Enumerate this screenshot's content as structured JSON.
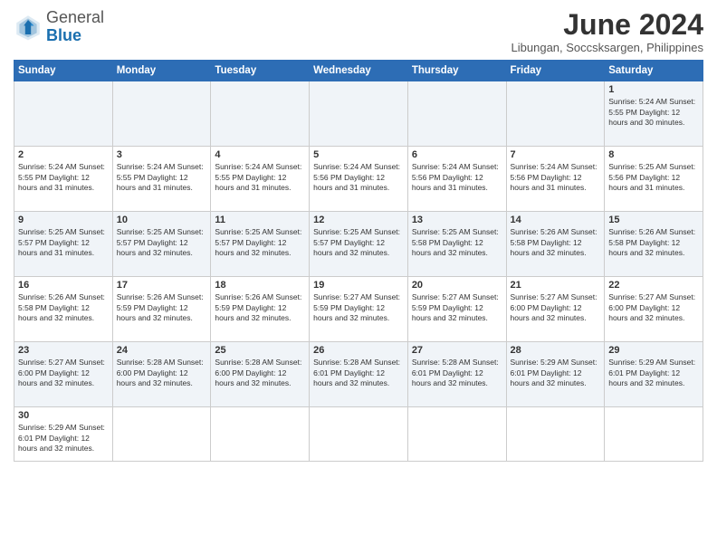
{
  "header": {
    "logo_general": "General",
    "logo_blue": "Blue",
    "month_title": "June 2024",
    "location": "Libungan, Soccsksargen, Philippines"
  },
  "days_of_week": [
    "Sunday",
    "Monday",
    "Tuesday",
    "Wednesday",
    "Thursday",
    "Friday",
    "Saturday"
  ],
  "weeks": [
    [
      {
        "day": "",
        "info": ""
      },
      {
        "day": "",
        "info": ""
      },
      {
        "day": "",
        "info": ""
      },
      {
        "day": "",
        "info": ""
      },
      {
        "day": "",
        "info": ""
      },
      {
        "day": "",
        "info": ""
      },
      {
        "day": "1",
        "info": "Sunrise: 5:24 AM\nSunset: 5:55 PM\nDaylight: 12 hours and 30 minutes."
      }
    ],
    [
      {
        "day": "2",
        "info": "Sunrise: 5:24 AM\nSunset: 5:55 PM\nDaylight: 12 hours and 31 minutes."
      },
      {
        "day": "3",
        "info": "Sunrise: 5:24 AM\nSunset: 5:55 PM\nDaylight: 12 hours and 31 minutes."
      },
      {
        "day": "4",
        "info": "Sunrise: 5:24 AM\nSunset: 5:55 PM\nDaylight: 12 hours and 31 minutes."
      },
      {
        "day": "5",
        "info": "Sunrise: 5:24 AM\nSunset: 5:56 PM\nDaylight: 12 hours and 31 minutes."
      },
      {
        "day": "6",
        "info": "Sunrise: 5:24 AM\nSunset: 5:56 PM\nDaylight: 12 hours and 31 minutes."
      },
      {
        "day": "7",
        "info": "Sunrise: 5:24 AM\nSunset: 5:56 PM\nDaylight: 12 hours and 31 minutes."
      },
      {
        "day": "8",
        "info": "Sunrise: 5:25 AM\nSunset: 5:56 PM\nDaylight: 12 hours and 31 minutes."
      }
    ],
    [
      {
        "day": "9",
        "info": "Sunrise: 5:25 AM\nSunset: 5:57 PM\nDaylight: 12 hours and 31 minutes."
      },
      {
        "day": "10",
        "info": "Sunrise: 5:25 AM\nSunset: 5:57 PM\nDaylight: 12 hours and 32 minutes."
      },
      {
        "day": "11",
        "info": "Sunrise: 5:25 AM\nSunset: 5:57 PM\nDaylight: 12 hours and 32 minutes."
      },
      {
        "day": "12",
        "info": "Sunrise: 5:25 AM\nSunset: 5:57 PM\nDaylight: 12 hours and 32 minutes."
      },
      {
        "day": "13",
        "info": "Sunrise: 5:25 AM\nSunset: 5:58 PM\nDaylight: 12 hours and 32 minutes."
      },
      {
        "day": "14",
        "info": "Sunrise: 5:26 AM\nSunset: 5:58 PM\nDaylight: 12 hours and 32 minutes."
      },
      {
        "day": "15",
        "info": "Sunrise: 5:26 AM\nSunset: 5:58 PM\nDaylight: 12 hours and 32 minutes."
      }
    ],
    [
      {
        "day": "16",
        "info": "Sunrise: 5:26 AM\nSunset: 5:58 PM\nDaylight: 12 hours and 32 minutes."
      },
      {
        "day": "17",
        "info": "Sunrise: 5:26 AM\nSunset: 5:59 PM\nDaylight: 12 hours and 32 minutes."
      },
      {
        "day": "18",
        "info": "Sunrise: 5:26 AM\nSunset: 5:59 PM\nDaylight: 12 hours and 32 minutes."
      },
      {
        "day": "19",
        "info": "Sunrise: 5:27 AM\nSunset: 5:59 PM\nDaylight: 12 hours and 32 minutes."
      },
      {
        "day": "20",
        "info": "Sunrise: 5:27 AM\nSunset: 5:59 PM\nDaylight: 12 hours and 32 minutes."
      },
      {
        "day": "21",
        "info": "Sunrise: 5:27 AM\nSunset: 6:00 PM\nDaylight: 12 hours and 32 minutes."
      },
      {
        "day": "22",
        "info": "Sunrise: 5:27 AM\nSunset: 6:00 PM\nDaylight: 12 hours and 32 minutes."
      }
    ],
    [
      {
        "day": "23",
        "info": "Sunrise: 5:27 AM\nSunset: 6:00 PM\nDaylight: 12 hours and 32 minutes."
      },
      {
        "day": "24",
        "info": "Sunrise: 5:28 AM\nSunset: 6:00 PM\nDaylight: 12 hours and 32 minutes."
      },
      {
        "day": "25",
        "info": "Sunrise: 5:28 AM\nSunset: 6:00 PM\nDaylight: 12 hours and 32 minutes."
      },
      {
        "day": "26",
        "info": "Sunrise: 5:28 AM\nSunset: 6:01 PM\nDaylight: 12 hours and 32 minutes."
      },
      {
        "day": "27",
        "info": "Sunrise: 5:28 AM\nSunset: 6:01 PM\nDaylight: 12 hours and 32 minutes."
      },
      {
        "day": "28",
        "info": "Sunrise: 5:29 AM\nSunset: 6:01 PM\nDaylight: 12 hours and 32 minutes."
      },
      {
        "day": "29",
        "info": "Sunrise: 5:29 AM\nSunset: 6:01 PM\nDaylight: 12 hours and 32 minutes."
      }
    ],
    [
      {
        "day": "30",
        "info": "Sunrise: 5:29 AM\nSunset: 6:01 PM\nDaylight: 12 hours and 32 minutes."
      },
      {
        "day": "",
        "info": ""
      },
      {
        "day": "",
        "info": ""
      },
      {
        "day": "",
        "info": ""
      },
      {
        "day": "",
        "info": ""
      },
      {
        "day": "",
        "info": ""
      },
      {
        "day": "",
        "info": ""
      }
    ]
  ]
}
